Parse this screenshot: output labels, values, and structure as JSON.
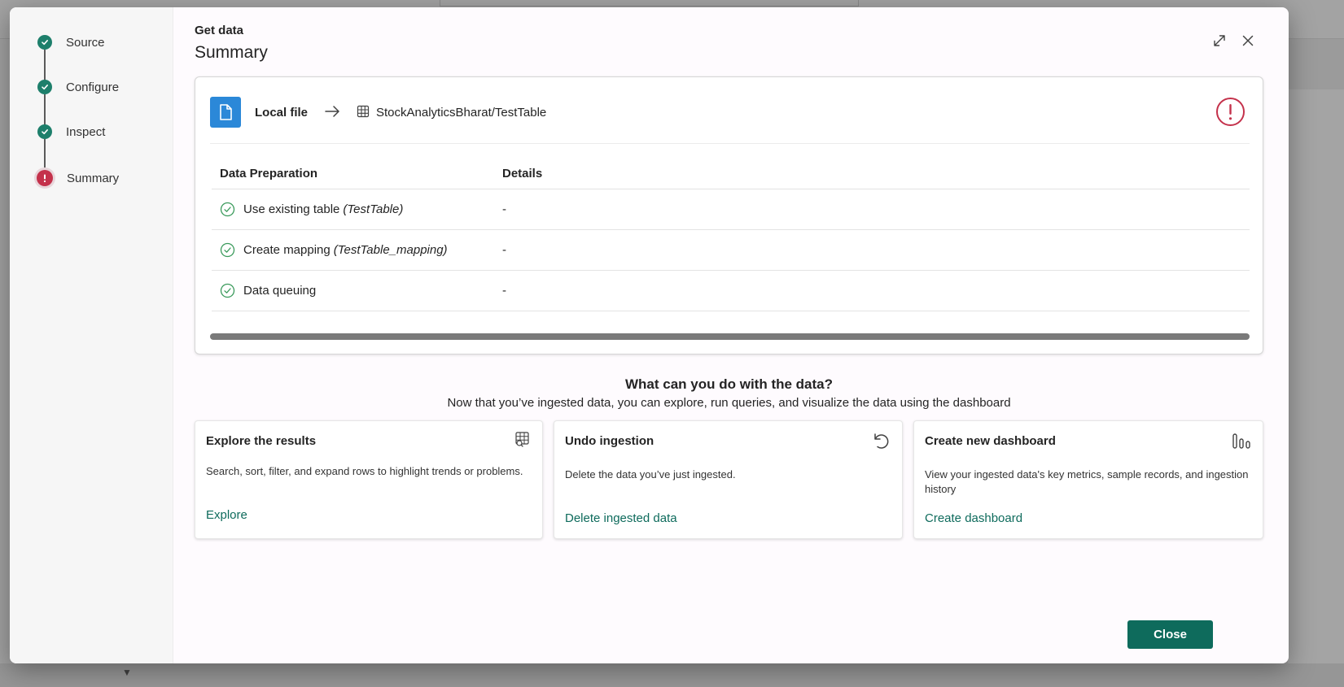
{
  "stepper": {
    "steps": [
      {
        "label": "Source",
        "status": "complete"
      },
      {
        "label": "Configure",
        "status": "complete"
      },
      {
        "label": "Inspect",
        "status": "complete"
      },
      {
        "label": "Summary",
        "status": "error"
      }
    ]
  },
  "header": {
    "eyebrow": "Get data",
    "title": "Summary",
    "expand_icon": "expand-icon",
    "close_icon": "close-icon"
  },
  "summary": {
    "source_icon": "document-icon",
    "source_label": "Local file",
    "arrow_icon": "arrow-right-icon",
    "destination_icon": "table-icon",
    "destination_label": "StockAnalyticsBharat/TestTable",
    "status_icon": "error-circle-icon",
    "table": {
      "columns": [
        "Data Preparation",
        "Details"
      ],
      "rows": [
        {
          "label": "Use existing table",
          "detail_name": "(TestTable)",
          "details": "-",
          "status": "success"
        },
        {
          "label": "Create mapping",
          "detail_name": "(TestTable_mapping)",
          "details": "-",
          "status": "success"
        },
        {
          "label": "Data queuing",
          "detail_name": "",
          "details": "-",
          "status": "success"
        }
      ]
    }
  },
  "next_steps": {
    "title": "What can you do with the data?",
    "subtitle": "Now that you’ve ingested data, you can explore, run queries, and visualize the data using the dashboard",
    "cards": [
      {
        "title": "Explore the results",
        "icon": "table-search-icon",
        "description": "Search, sort, filter, and expand rows to highlight trends or problems.",
        "link": "Explore"
      },
      {
        "title": "Undo ingestion",
        "icon": "undo-icon",
        "description": "Delete the data you’ve just ingested.",
        "link": "Delete ingested data"
      },
      {
        "title": "Create new dashboard",
        "icon": "bar-chart-icon",
        "description": "View your ingested data's key metrics, sample records, and ingestion history",
        "link": "Create dashboard"
      }
    ]
  },
  "footer": {
    "close_label": "Close"
  },
  "colors": {
    "accent": "#0e6b5c",
    "step_complete": "#1d7f6b",
    "error": "#c4314b",
    "success": "#3a9a5b",
    "file_icon_bg": "#2b88d8"
  }
}
